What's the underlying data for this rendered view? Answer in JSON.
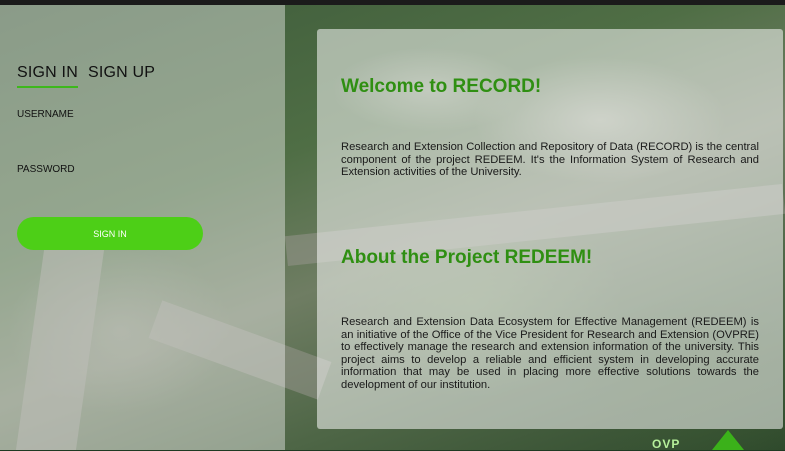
{
  "auth": {
    "tabs": [
      {
        "label": "SIGN IN",
        "active": true
      },
      {
        "label": "SIGN UP",
        "active": false
      }
    ],
    "username_label": "USERNAME",
    "username_value": "",
    "password_label": "PASSWORD",
    "password_value": "",
    "signin_button": "SIGN IN"
  },
  "info": {
    "welcome_title": "Welcome to RECORD!",
    "welcome_text": "Research and Extension Collection and Repository of Data (RECORD) is the central component of the project REDEEM. It's the Information System of Research and Extension activities of the University.",
    "about_title": "About the Project REDEEM!",
    "about_text": "Research and Extension Data Ecosystem for Effective Management (REDEEM) is an initiative of the Office of the Vice President for Research and Extension (OVPRE) to effectively manage the research and extension information of the university. This project aims to develop a reliable and efficient system in developing accurate information that may be used in placing more effective solutions towards the development of our institution."
  },
  "footer": {
    "ovp_logo": "OVP"
  },
  "colors": {
    "accent": "#4dcf17",
    "heading": "#2f8f12"
  }
}
